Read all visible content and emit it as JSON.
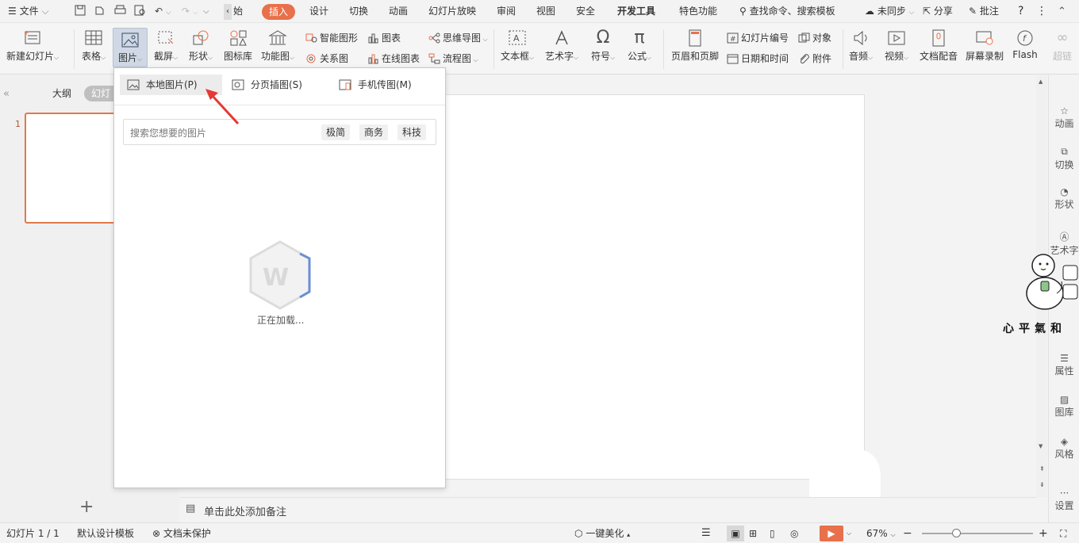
{
  "menu": {
    "file": "文件",
    "tabs": [
      "开始",
      "插入",
      "设计",
      "切换",
      "动画",
      "幻灯片放映",
      "审阅",
      "视图",
      "安全",
      "开发工具",
      "特色功能"
    ],
    "search": "查找命令、搜索模板",
    "sync": "未同步",
    "share": "分享",
    "comment": "批注"
  },
  "ribbon": {
    "new_slide": "新建幻灯片",
    "table": "表格",
    "picture": "图片",
    "screenshot": "截屏",
    "shape": "形状",
    "icon_lib": "图标库",
    "func_chart": "功能图",
    "smart_shape": "智能图形",
    "chart": "图表",
    "relation": "关系图",
    "online_chart": "在线图表",
    "mindmap": "思维导图",
    "flowchart": "流程图",
    "textbox": "文本框",
    "wordart": "艺术字",
    "symbol": "符号",
    "formula": "公式",
    "header_footer": "页眉和页脚",
    "slide_number": "幻灯片编号",
    "object": "对象",
    "datetime": "日期和时间",
    "attachment": "附件",
    "audio": "音频",
    "video": "视频",
    "doc_dub": "文档配音",
    "screen_rec": "屏幕录制",
    "flash": "Flash",
    "hyperlink": "超链"
  },
  "left": {
    "outline_tab": "大纲",
    "slides_tab": "幻灯",
    "slide_num": "1",
    "add": "+"
  },
  "dropdown": {
    "tab_local": "本地图片(P)",
    "tab_split": "分页插图(S)",
    "tab_phone": "手机传图(M)",
    "search_placeholder": "搜索您想要的图片",
    "tags": [
      "极简",
      "商务",
      "科技"
    ],
    "loading": "正在加载..."
  },
  "notes_placeholder": "单击此处添加备注",
  "right_sidebar": [
    "动画",
    "切换",
    "形状",
    "艺术字",
    "属性",
    "图库",
    "风格",
    "设置"
  ],
  "sticker_text": "心平氣和",
  "status": {
    "slide_info": "幻灯片 1 / 1",
    "template": "默认设计模板",
    "protect": "文档未保护",
    "beautify": "一键美化",
    "zoom": "67%"
  },
  "colors": {
    "accent": "#e8704a",
    "arrow": "#e53935",
    "thumb_border": "#e07a4b"
  }
}
